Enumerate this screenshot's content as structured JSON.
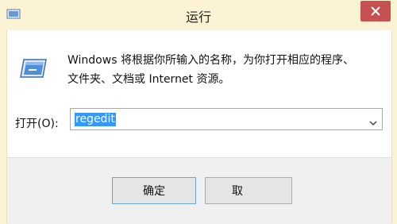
{
  "window": {
    "title": "运行"
  },
  "description": {
    "line1": "Windows 将根据你所输入的名称，为你打开相应的程序、",
    "line2": "文件夹、文档或 Internet 资源。"
  },
  "open_field": {
    "label": "打开(O):",
    "value": "regedit"
  },
  "buttons": {
    "ok_label": "确定",
    "cancel_label": "取"
  },
  "icons": {
    "title": "run-window-icon",
    "dialog": "run-dialog-icon",
    "close": "close-icon",
    "dropdown": "chevron-down-icon"
  },
  "colors": {
    "selection": "#3399ff",
    "close_button": "#c75050",
    "title_bg": "#fbf3d3"
  }
}
